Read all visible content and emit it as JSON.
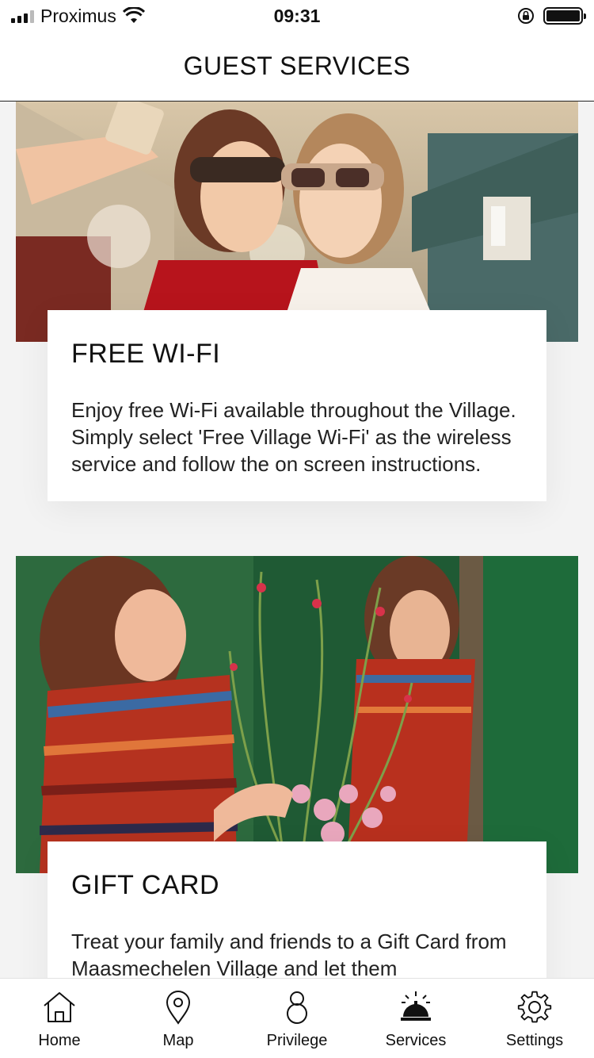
{
  "status_bar": {
    "carrier": "Proximus",
    "time": "09:31"
  },
  "header": {
    "title": "GUEST SERVICES"
  },
  "cards": [
    {
      "title": "FREE WI-FI",
      "body": "Enjoy free Wi-Fi available throughout the Village. Simply select 'Free Village Wi-Fi' as the wireless service and follow the on screen instructions."
    },
    {
      "title": "GIFT CARD",
      "body": "Treat your family and friends to a Gift Card from Maasmechelen Village and let them"
    }
  ],
  "tabbar": {
    "items": [
      {
        "label": "Home",
        "icon": "home-icon"
      },
      {
        "label": "Map",
        "icon": "map-pin-icon"
      },
      {
        "label": "Privilege",
        "icon": "privilege-icon"
      },
      {
        "label": "Services",
        "icon": "service-bell-icon"
      },
      {
        "label": "Settings",
        "icon": "gear-icon"
      }
    ]
  }
}
